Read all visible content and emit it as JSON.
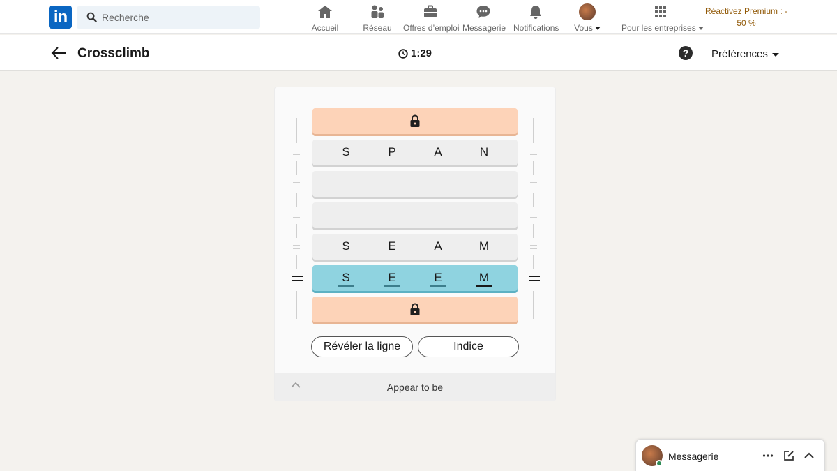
{
  "nav": {
    "logo": "in",
    "search_placeholder": "Recherche",
    "items": [
      {
        "label": "Accueil",
        "icon": "home-icon"
      },
      {
        "label": "Réseau",
        "icon": "network-icon"
      },
      {
        "label": "Offres d’emploi",
        "icon": "briefcase-icon"
      },
      {
        "label": "Messagerie",
        "icon": "messaging-icon"
      },
      {
        "label": "Notifications",
        "icon": "bell-icon"
      },
      {
        "label": "Vous",
        "icon": "avatar"
      }
    ],
    "business": {
      "label": "Pour les entreprises",
      "icon": "grid-icon"
    },
    "premium": {
      "line1": "Réactivez Premium : -",
      "line2": "50 %"
    }
  },
  "game": {
    "title": "Crossclimb",
    "timer": "1:29",
    "preferences": "Préférences",
    "help": "?",
    "rows": [
      {
        "state": "locked",
        "letters": []
      },
      {
        "state": "filled",
        "letters": [
          "S",
          "P",
          "A",
          "N"
        ]
      },
      {
        "state": "empty",
        "letters": []
      },
      {
        "state": "empty",
        "letters": []
      },
      {
        "state": "filled",
        "letters": [
          "S",
          "E",
          "A",
          "M"
        ]
      },
      {
        "state": "active",
        "letters": [
          "S",
          "E",
          "E",
          "M"
        ]
      },
      {
        "state": "locked",
        "letters": []
      }
    ],
    "buttons": {
      "reveal": "Révéler la ligne",
      "hint": "Indice"
    },
    "clue": "Appear to be"
  },
  "messaging": {
    "title": "Messagerie"
  },
  "colors": {
    "brand": "#0a66c2",
    "locked": "#fdd3b8",
    "active": "#8fd3e0",
    "premium": "#915907"
  }
}
